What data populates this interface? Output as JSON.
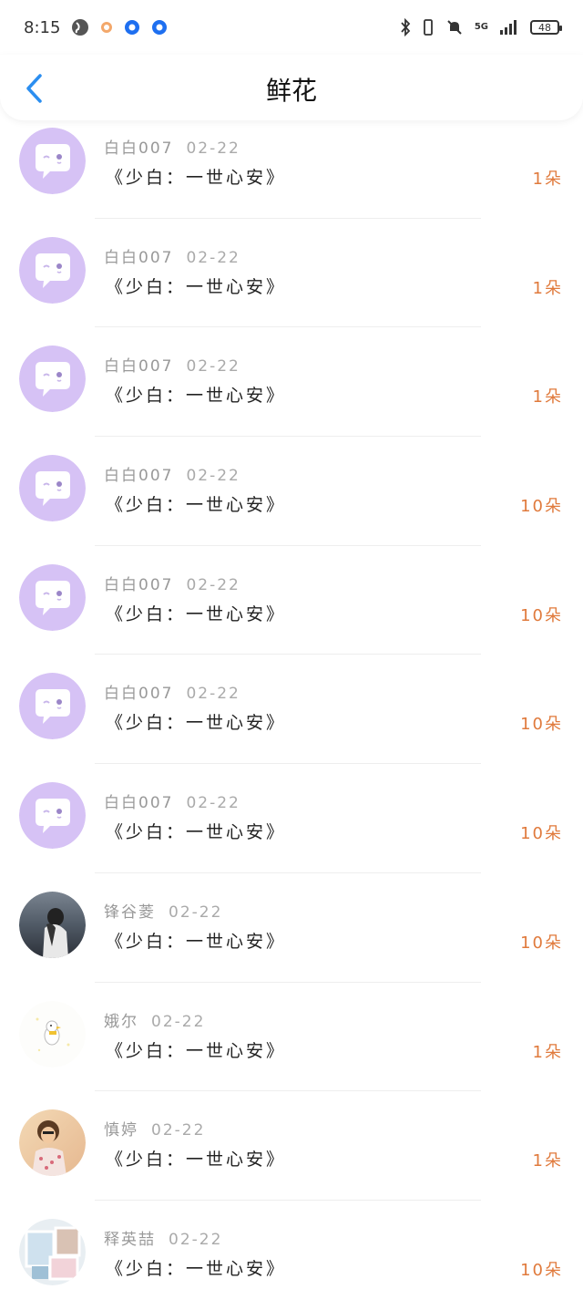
{
  "status_bar": {
    "time": "8:15",
    "network": "5G",
    "battery": "48"
  },
  "header": {
    "title": "鲜花"
  },
  "items": [
    {
      "user": "白白007",
      "date": "02-22",
      "title": "《少白：一世心安》",
      "amount": "1朵",
      "avatar": "chat-bubble"
    },
    {
      "user": "白白007",
      "date": "02-22",
      "title": "《少白：一世心安》",
      "amount": "1朵",
      "avatar": "chat-bubble"
    },
    {
      "user": "白白007",
      "date": "02-22",
      "title": "《少白：一世心安》",
      "amount": "1朵",
      "avatar": "chat-bubble"
    },
    {
      "user": "白白007",
      "date": "02-22",
      "title": "《少白：一世心安》",
      "amount": "10朵",
      "avatar": "chat-bubble"
    },
    {
      "user": "白白007",
      "date": "02-22",
      "title": "《少白：一世心安》",
      "amount": "10朵",
      "avatar": "chat-bubble"
    },
    {
      "user": "白白007",
      "date": "02-22",
      "title": "《少白：一世心安》",
      "amount": "10朵",
      "avatar": "chat-bubble"
    },
    {
      "user": "白白007",
      "date": "02-22",
      "title": "《少白：一世心安》",
      "amount": "10朵",
      "avatar": "chat-bubble"
    },
    {
      "user": "锋谷菱",
      "date": "02-22",
      "title": "《少白：一世心安》",
      "amount": "10朵",
      "avatar": "photo-dark"
    },
    {
      "user": "娥尔",
      "date": "02-22",
      "title": "《少白：一世心安》",
      "amount": "1朵",
      "avatar": "duck-sticker"
    },
    {
      "user": "慎婷",
      "date": "02-22",
      "title": "《少白：一世心安》",
      "amount": "1朵",
      "avatar": "photo-girl"
    },
    {
      "user": "释英喆",
      "date": "02-22",
      "title": "《少白：一世心安》",
      "amount": "10朵",
      "avatar": "photo-room"
    }
  ],
  "colors": {
    "accent_blue": "#2b8ef0",
    "amount_orange": "#e07a3c",
    "avatar_purple": "#d6c2f5"
  }
}
